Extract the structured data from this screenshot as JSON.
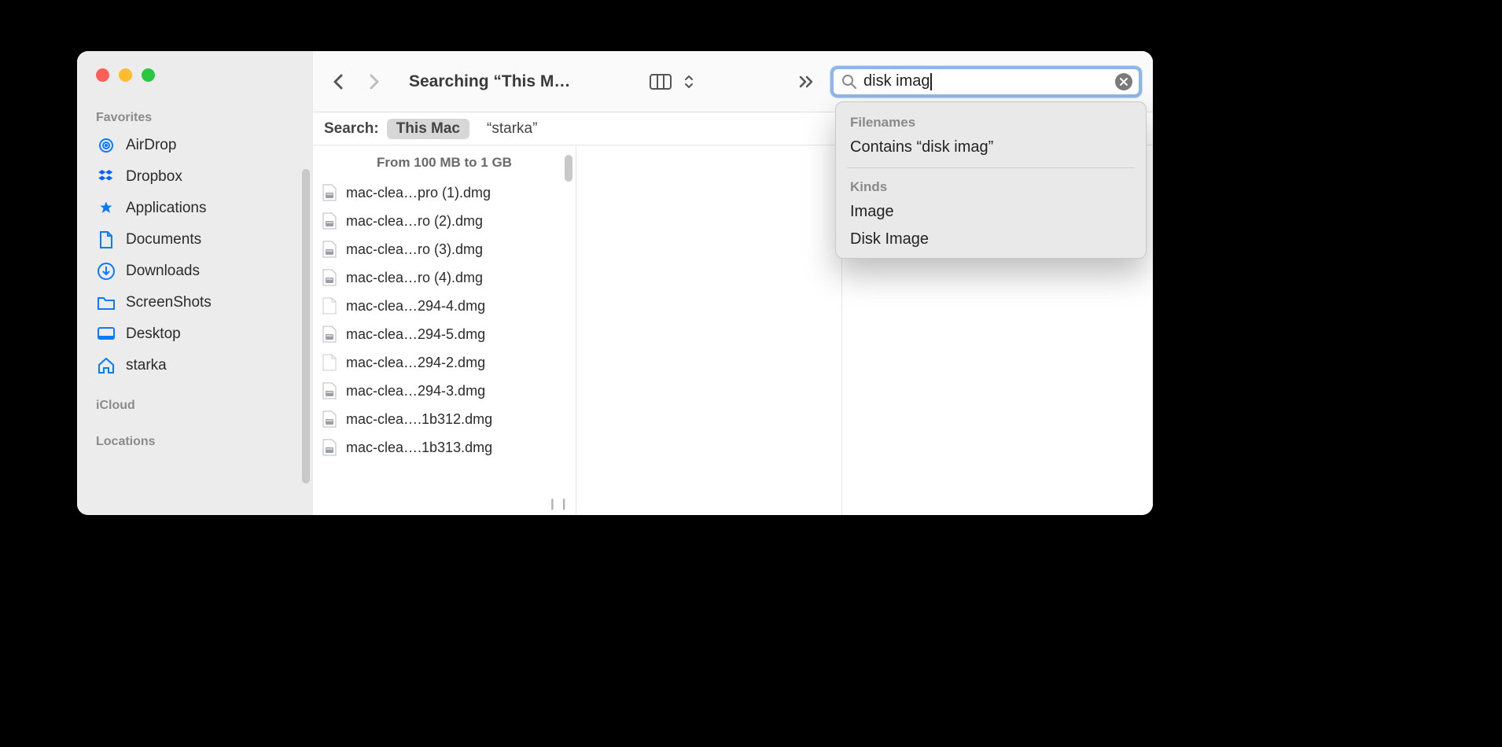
{
  "window": {
    "title": "Searching “This M…"
  },
  "sidebar": {
    "sections": {
      "favorites": "Favorites",
      "icloud": "iCloud",
      "locations": "Locations"
    },
    "items": [
      {
        "label": "AirDrop",
        "icon": "airdrop"
      },
      {
        "label": "Dropbox",
        "icon": "dropbox"
      },
      {
        "label": "Applications",
        "icon": "applications"
      },
      {
        "label": "Documents",
        "icon": "document"
      },
      {
        "label": "Downloads",
        "icon": "download"
      },
      {
        "label": "ScreenShots",
        "icon": "folder"
      },
      {
        "label": "Desktop",
        "icon": "desktop"
      },
      {
        "label": "starka",
        "icon": "home"
      }
    ]
  },
  "search": {
    "query": "disk imag",
    "scope_label": "Search:",
    "scopes": [
      {
        "label": "This Mac",
        "active": true
      },
      {
        "label": "“starka”",
        "active": false
      }
    ]
  },
  "suggestions": {
    "filenames_header": "Filenames",
    "filenames_item": "Contains “disk imag”",
    "kinds_header": "Kinds",
    "kinds": [
      "Image",
      "Disk Image"
    ]
  },
  "column": {
    "header": "From 100 MB to 1 GB",
    "files": [
      {
        "name": "mac-clea…pro (1).dmg",
        "kind": "dmg"
      },
      {
        "name": "mac-clea…ro (2).dmg",
        "kind": "dmg"
      },
      {
        "name": "mac-clea…ro (3).dmg",
        "kind": "dmg"
      },
      {
        "name": "mac-clea…ro (4).dmg",
        "kind": "dmg"
      },
      {
        "name": "mac-clea…294-4.dmg",
        "kind": "blank"
      },
      {
        "name": "mac-clea…294-5.dmg",
        "kind": "dmg"
      },
      {
        "name": "mac-clea…294-2.dmg",
        "kind": "blank"
      },
      {
        "name": "mac-clea…294-3.dmg",
        "kind": "dmg"
      },
      {
        "name": "mac-clea….1b312.dmg",
        "kind": "dmg"
      },
      {
        "name": "mac-clea….1b313.dmg",
        "kind": "dmg"
      }
    ]
  }
}
